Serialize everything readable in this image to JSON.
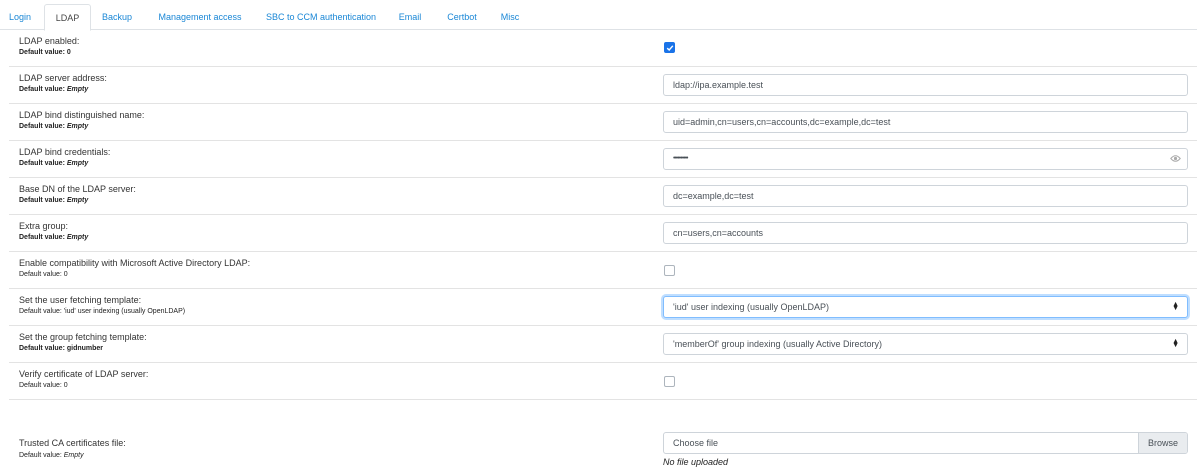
{
  "tabs": [
    "Login",
    "LDAP",
    "Backup",
    "Management access",
    "SBC to CCM authentication",
    "Email",
    "Certbot",
    "Misc"
  ],
  "active_tab": "LDAP",
  "fields": [
    {
      "label": "LDAP enabled:",
      "default_key": "Default value: ",
      "default_val": "0",
      "control": "checkbox",
      "checked": true
    },
    {
      "label": "LDAP server address:",
      "default_key": "Default value: ",
      "default_val": "Empty",
      "control": "text",
      "value": "ldap://ipa.example.test"
    },
    {
      "label": "LDAP bind distinguished name:",
      "default_key": "Default value: ",
      "default_val": "Empty",
      "control": "text",
      "value": "uid=admin,cn=users,cn=accounts,dc=example,dc=test"
    },
    {
      "label": "LDAP bind credentials:",
      "default_key": "Default value: ",
      "default_val": "Empty",
      "control": "password",
      "value": "••••••••••"
    },
    {
      "label": "Base DN of the LDAP server:",
      "default_key": "Default value: ",
      "default_val": "Empty",
      "control": "text",
      "value": "dc=example,dc=test"
    },
    {
      "label": "Extra group:",
      "default_key": "Default value: ",
      "default_val": "Empty",
      "control": "text",
      "value": "cn=users,cn=accounts"
    },
    {
      "label": "Enable compatibility with Microsoft Active Directory LDAP:",
      "default_key": "Default value: ",
      "default_val": "0",
      "control": "checkbox",
      "checked": false
    },
    {
      "label": "Set the user fetching template:",
      "default_key": "Default value: ",
      "default_val": "'iud' user indexing (usually OpenLDAP)",
      "control": "select",
      "value": "'iud' user indexing (usually OpenLDAP)"
    },
    {
      "label": "Set the group fetching template:",
      "default_key": "Default value: ",
      "default_val": "gidnumber",
      "control": "select",
      "value": "'memberOf' group indexing (usually Active Directory)"
    },
    {
      "label": "Verify certificate of LDAP server:",
      "default_key": "Default value: ",
      "default_val": "0",
      "control": "checkbox",
      "checked": false
    },
    {
      "label": "Trusted CA certificates file:",
      "default_key": "Default value: ",
      "default_val": "Empty",
      "control": "file",
      "value": "Choose file",
      "button": "Browse",
      "status": "No file uploaded"
    }
  ],
  "colors": {
    "link": "#1a87d6",
    "checkbox_on": "#1a73e8",
    "focus": "#80bdff"
  }
}
